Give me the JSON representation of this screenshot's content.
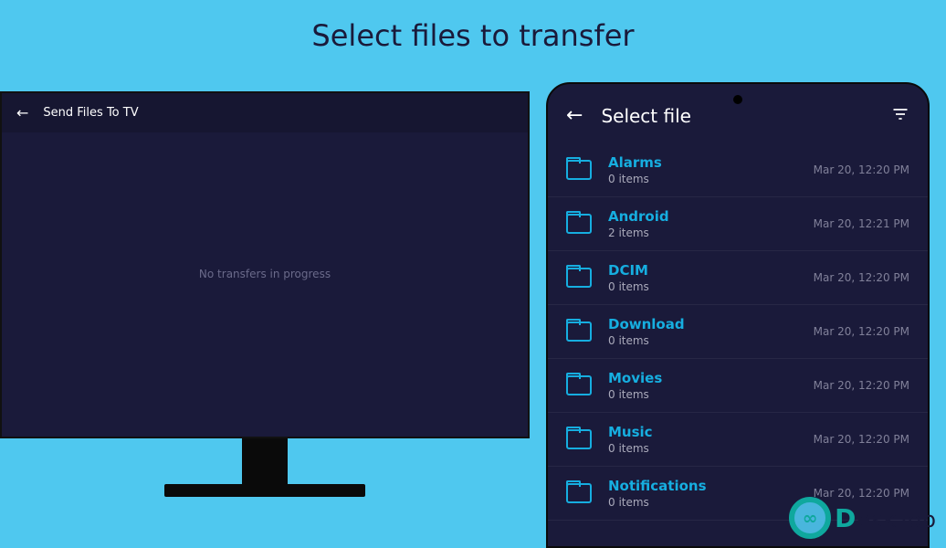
{
  "headline": "Select files to transfer",
  "tv": {
    "title": "Send Files To TV",
    "empty": "No transfers in progress"
  },
  "phone": {
    "title": "Select file",
    "items": [
      {
        "name": "Alarms",
        "sub": "0 items",
        "date": "Mar 20, 12:20 PM"
      },
      {
        "name": "Android",
        "sub": "2 items",
        "date": "Mar 20, 12:21 PM"
      },
      {
        "name": "DCIM",
        "sub": "0 items",
        "date": "Mar 20, 12:20 PM"
      },
      {
        "name": "Download",
        "sub": "0 items",
        "date": "Mar 20, 12:20 PM"
      },
      {
        "name": "Movies",
        "sub": "0 items",
        "date": "Mar 20, 12:20 PM"
      },
      {
        "name": "Music",
        "sub": "0 items",
        "date": "Mar 20, 12:20 PM"
      },
      {
        "name": "Notifications",
        "sub": "0 items",
        "date": "Mar 20, 12:20 PM"
      }
    ]
  },
  "watermark": {
    "symbol": "∞",
    "brand_first": "D",
    "brand_rest": "eskTop"
  }
}
